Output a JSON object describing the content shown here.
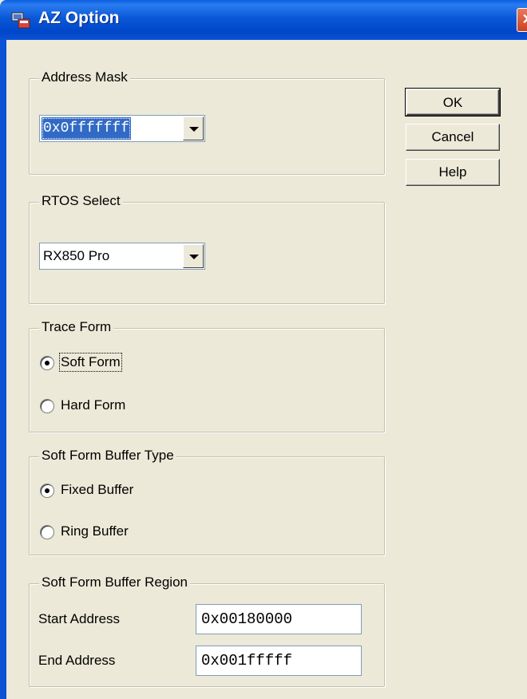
{
  "window": {
    "title": "AZ Option",
    "icon": "app-icon",
    "close_glyph": "✕"
  },
  "buttons": {
    "ok": "OK",
    "cancel": "Cancel",
    "help": "Help"
  },
  "address_mask": {
    "label": "Address Mask",
    "value": "0x0fffffff"
  },
  "rtos_select": {
    "label": "RTOS Select",
    "value": "RX850 Pro"
  },
  "trace_form": {
    "label": "Trace Form",
    "options": [
      {
        "label": "Soft Form",
        "checked": true
      },
      {
        "label": "Hard Form",
        "checked": false
      }
    ]
  },
  "buffer_type": {
    "label": "Soft Form Buffer Type",
    "options": [
      {
        "label": "Fixed Buffer",
        "checked": true
      },
      {
        "label": "Ring Buffer",
        "checked": false
      }
    ]
  },
  "buffer_region": {
    "label": "Soft Form Buffer Region",
    "start_label": "Start Address",
    "start_value": "0x00180000",
    "end_label": "End Address",
    "end_value": "0x001fffff"
  }
}
